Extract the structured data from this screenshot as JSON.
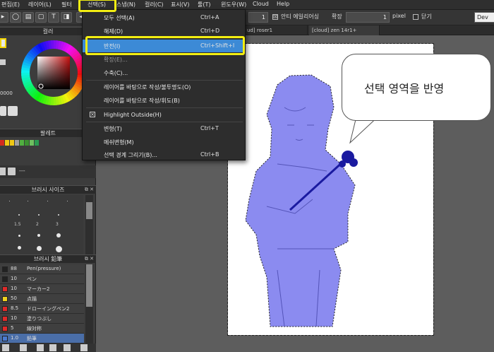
{
  "menubar": {
    "items": [
      "편집(E)",
      "레이어(L)",
      "필터",
      "선택(S)",
      "스냅(N)",
      "컬러(C)",
      "표시(V)",
      "툴(T)",
      "윈도우(W)",
      "Cloud",
      "Help"
    ]
  },
  "toolbar": {
    "value1": "1",
    "antialias_label": "안티 에일리어싱",
    "antialias_checked": "☒",
    "zoom_label": "확장",
    "zoom_value": "1",
    "unit": "pixel",
    "close_label": "닫기",
    "preset_label": "Dev"
  },
  "panels": {
    "color_title": "컬러",
    "palette_title": "팔레트",
    "brush_size_title": "브러시 사이즈",
    "brush_title": "브러시 鉛筆",
    "hex_fragment": "0000",
    "dashes": "---",
    "brush_sizes": [
      "1.5",
      "2",
      "3"
    ],
    "palette_colors": [
      "#d42a1e",
      "#f0c814",
      "#f0c814",
      "#a0a0a0",
      "#50b040",
      "#3a9030",
      "#6ec060",
      "#2a9a50"
    ]
  },
  "brushes": [
    {
      "color": "#222222",
      "size": "88",
      "name": "Pen(pressure)"
    },
    {
      "color": "#222222",
      "size": "10",
      "name": "ペン"
    },
    {
      "color": "#e02a2a",
      "size": "10",
      "name": "マーカー2"
    },
    {
      "color": "#f0d21e",
      "size": "50",
      "name": "点描"
    },
    {
      "color": "#e02a2a",
      "size": "8.5",
      "name": "ドローイングペン2"
    },
    {
      "color": "#e02a2a",
      "size": "10",
      "name": "塗りつぶし"
    },
    {
      "color": "#e02a2a",
      "size": "5",
      "name": "線対称"
    },
    {
      "color": "#4a7ad0",
      "size": "1.0",
      "name": "鉛筆"
    }
  ],
  "tabs": [
    "ud] roser1",
    "[cloud] zen 14r1+"
  ],
  "menu": {
    "items": [
      {
        "label": "모두 선택(A)",
        "shortcut": "Ctrl+A"
      },
      {
        "label": "해제(D)",
        "shortcut": "Ctrl+D"
      },
      {
        "label": "반전(I)",
        "shortcut": "Ctrl+Shift+I"
      },
      {
        "label": "확장(E)...",
        "shortcut": ""
      },
      {
        "label": "수축(C)...",
        "shortcut": ""
      },
      {
        "label": "레이어를 바탕으로 작성/불투명도(O)",
        "shortcut": ""
      },
      {
        "label": "레이어를 바탕으로 작성/휘도(B)",
        "shortcut": ""
      },
      {
        "label": "Highlight Outside(H)",
        "shortcut": ""
      },
      {
        "label": "변형(T)",
        "shortcut": "Ctrl+T"
      },
      {
        "label": "메쉬변형(M)",
        "shortcut": ""
      },
      {
        "label": "선택 경계 그리기(B)...",
        "shortcut": "Ctrl+B"
      }
    ]
  },
  "annotation": {
    "bubble_text": "선택 영역을 반영"
  },
  "colors": {
    "menu_bg": "#2d2d2d",
    "highlight_bg": "#3c8ad6",
    "annotation_yellow": "#f3ee12",
    "selection_fill": "#8b8bf0",
    "rose": "#1a1aa0"
  }
}
